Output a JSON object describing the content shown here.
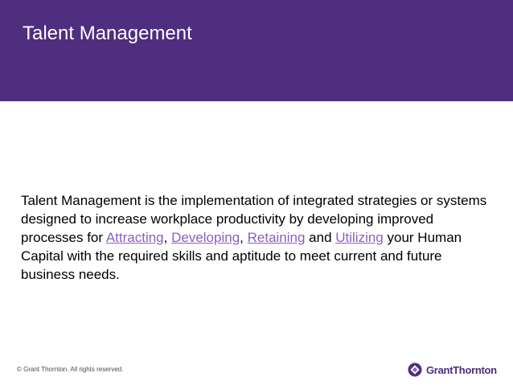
{
  "slide": {
    "title": "Talent Management",
    "paragraph": {
      "intro": "Talent Management is the implementation of integrated strategies or systems designed to increase workplace productivity by developing improved processes for ",
      "link1": "Attracting",
      "sep1": ", ",
      "link2": "Developing",
      "sep2": ", ",
      "link3": "Retaining",
      "sep3": " and ",
      "link4": "Utilizing",
      "outro": " your Human Capital with the required skills and aptitude to meet current and future business needs."
    }
  },
  "footer": {
    "copyright": "© Grant Thornton. All rights reserved.",
    "logo_text": "GrantThornton",
    "logo_icon": "grant-thornton-mark-icon"
  },
  "colors": {
    "brand_purple": "#4f2d7f",
    "link_purple": "#8c5ec1",
    "background": "#ffffff"
  }
}
